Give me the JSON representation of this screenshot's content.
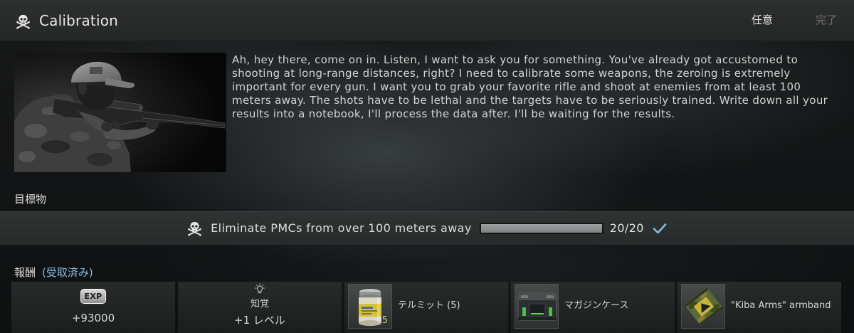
{
  "quest": {
    "icon": "skull-icon",
    "title": "Calibration",
    "type_label": "任意",
    "complete_label": "完了",
    "image_icon": "soldier-with-rifle-image",
    "description_lines": [
      "Ah, hey there, come on in. Listen, I want to ask you for something. You've already got accustomed to",
      "shooting at long-range distances, right? I need to calibrate some weapons, the zeroing is extremely",
      "important for every gun. I want you to grab your favorite rifle and shoot at enemies from at least 100",
      "meters away. The shots have to be lethal and the targets have to be seriously trained. Write down all your",
      "results into a notebook, I'll process the data after. I'll be waiting for the results."
    ]
  },
  "objectives": {
    "heading": "目標物",
    "items": [
      {
        "icon": "skull-icon",
        "text": "Eliminate PMCs from over 100 meters away",
        "progress_fraction": 1,
        "progress_label": "20/20",
        "completed": true,
        "check_icon": "checkmark-icon"
      }
    ]
  },
  "rewards": {
    "heading": "報酬",
    "status": "(受取済み)",
    "items": [
      {
        "icon": "exp-badge-icon",
        "badge": "EXP",
        "value": "+93000"
      },
      {
        "icon": "lightbulb-icon",
        "skill": "知覚",
        "value": "+1 レベル"
      },
      {
        "icon": "thermite-jar-icon",
        "name": "テルミット (5)",
        "count": "5"
      },
      {
        "icon": "magazine-case-icon",
        "name": "マガジンケース"
      },
      {
        "icon": "armband-icon",
        "name": "\"Kiba Arms\" armband"
      }
    ]
  },
  "colors": {
    "accent": "#86bde3",
    "muted": "#6e6e6e",
    "count": "#b3c98d"
  }
}
